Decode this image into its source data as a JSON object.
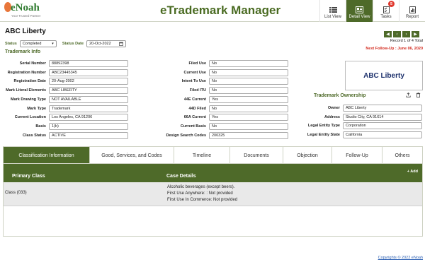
{
  "header": {
    "logo_text": "eNoah",
    "logo_tagline": "Your Trusted Partner",
    "app_title": "eTrademark Manager",
    "nav": [
      {
        "label": "List View",
        "icon": "list-view-icon"
      },
      {
        "label": "Detail View",
        "icon": "detail-view-icon"
      },
      {
        "label": "Tasks",
        "icon": "tasks-icon",
        "badge": "5"
      },
      {
        "label": "Report",
        "icon": "report-icon"
      }
    ]
  },
  "page": {
    "title": "ABC Liberty",
    "record_info": "Record 1 of 4 Total",
    "follow_up": "Next Follow-Up : June 06, 2020",
    "status_label": "Status",
    "status_value": "Completed",
    "status_date_label": "Status Date",
    "status_date_value": "20-Oct-2022"
  },
  "trademark_info": {
    "title": "Trademark Info",
    "left": [
      {
        "label": "Serial Number",
        "value": "88892398"
      },
      {
        "label": "Registration Number",
        "value": "ABC23445345"
      },
      {
        "label": "Registration Date",
        "value": "20-Aug-2002"
      },
      {
        "label": "Mark Literal Elements",
        "value": "ABC LIBERTY"
      },
      {
        "label": "Mark Drawing Type",
        "value": "NOT AVAILABLE"
      },
      {
        "label": "Mark Type",
        "value": "Trademark"
      },
      {
        "label": "Current Location",
        "value": "Los Angeles, CA 91206"
      },
      {
        "label": "Basis",
        "value": "1(b)"
      },
      {
        "label": "Class Status",
        "value": "ACTIVE"
      }
    ],
    "middle": [
      {
        "label": "Filed Use",
        "value": "No"
      },
      {
        "label": "Current Use",
        "value": "No"
      },
      {
        "label": "Intent To Use",
        "value": "No"
      },
      {
        "label": "Filed ITU",
        "value": "No"
      },
      {
        "label": "44E Current",
        "value": "Yes"
      },
      {
        "label": "44D Filed",
        "value": "No"
      },
      {
        "label": "66A Current",
        "value": "Yes"
      },
      {
        "label": "Current Basis",
        "value": "No"
      },
      {
        "label": "Design Search Codes",
        "value": "200325"
      }
    ]
  },
  "brand_box": "ABC Liberty",
  "ownership": {
    "title": "Trademark Ownership",
    "fields": [
      {
        "label": "Owner",
        "value": "ABC Liberty"
      },
      {
        "label": "Address",
        "value": "Studio City, CA 91614"
      },
      {
        "label": "Legal Entity Type",
        "value": "Corporation"
      },
      {
        "label": "Legal Entity State",
        "value": "California"
      }
    ]
  },
  "tabs": [
    {
      "label": "Classification Information",
      "active": true
    },
    {
      "label": "Good, Services, and Codes",
      "active": false
    },
    {
      "label": "Timeline",
      "active": false
    },
    {
      "label": "Documents",
      "active": false
    },
    {
      "label": "Objection",
      "active": false
    },
    {
      "label": "Follow-Up",
      "active": false
    },
    {
      "label": "Others",
      "active": false
    }
  ],
  "grid": {
    "add_label": "+ Add",
    "col_primary": "Primary Class",
    "col_details": "Case Details",
    "row": {
      "class": "Class (033)",
      "details": [
        "Alcoholic beverages (except beers).",
        "First Use Anywhere: : Not provided",
        "First Use In Commerce: Not provided"
      ]
    }
  },
  "footer": "Copyrights © 2022 eNoah",
  "colors": {
    "accent": "#4e6a29",
    "alert": "#d32b1f",
    "link": "#2b5fb3"
  }
}
